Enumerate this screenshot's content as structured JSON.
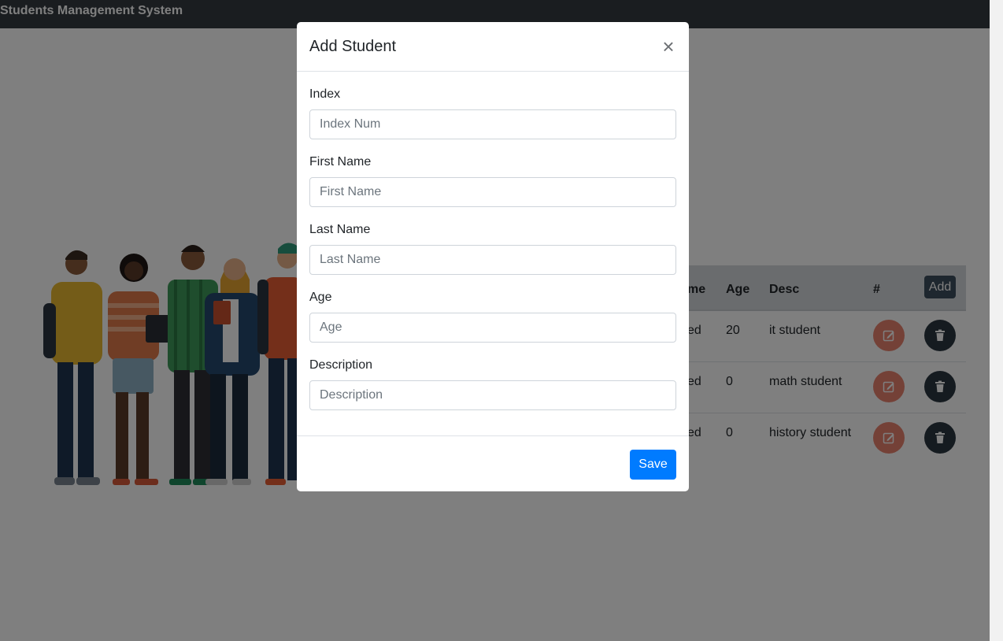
{
  "app": {
    "title": "Students Management System"
  },
  "table": {
    "columns": [
      "me",
      "Age",
      "Desc",
      "#"
    ],
    "add_label": "Add",
    "rows": [
      {
        "name": "ed",
        "age": "20",
        "desc": "it student"
      },
      {
        "name": "ed",
        "age": "0",
        "desc": "math student"
      },
      {
        "name": "ed",
        "age": "0",
        "desc": "history student"
      }
    ],
    "actions": {
      "edit_icon": "edit-icon",
      "delete_icon": "trash-icon"
    }
  },
  "modal": {
    "title": "Add Student",
    "close_label": "×",
    "fields": [
      {
        "label": "Index",
        "placeholder": "Index Num",
        "value": ""
      },
      {
        "label": "First Name",
        "placeholder": "First Name",
        "value": ""
      },
      {
        "label": "Last Name",
        "placeholder": "Last Name",
        "value": ""
      },
      {
        "label": "Age",
        "placeholder": "Age",
        "value": ""
      },
      {
        "label": "Description",
        "placeholder": "Description",
        "value": ""
      }
    ],
    "save_label": "Save"
  },
  "colors": {
    "navbar": "#343a40",
    "primary": "#007bff",
    "edit": "#e9826f",
    "delete": "#2b3641"
  }
}
